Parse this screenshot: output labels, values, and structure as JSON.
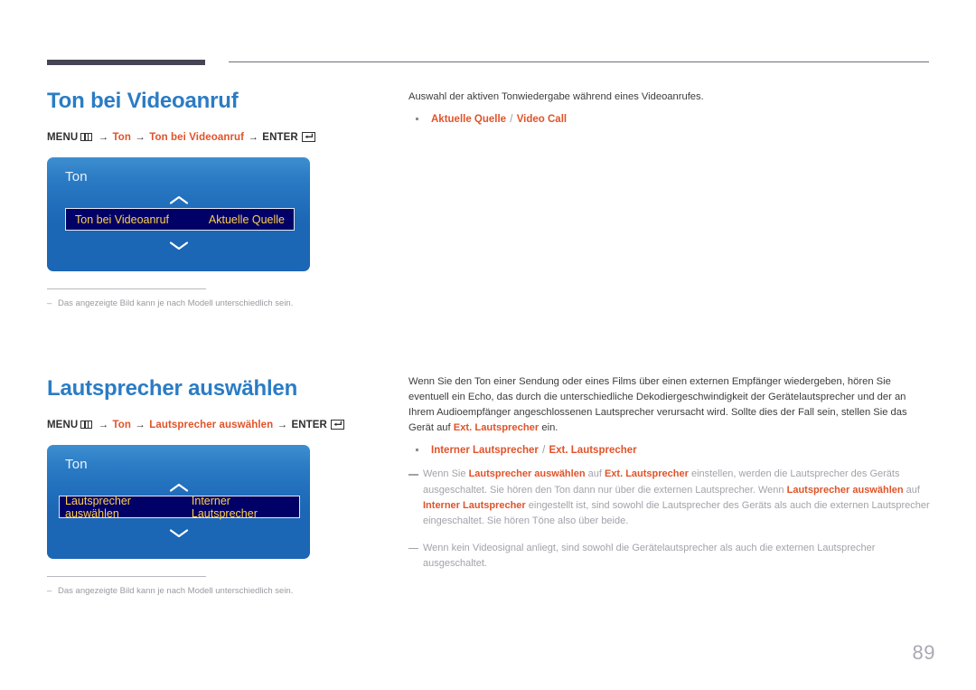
{
  "page": {
    "number": "89"
  },
  "sections": [
    {
      "title": "Ton bei Videoanruf",
      "menu_path": {
        "menu_label": "MENU",
        "arrow": "→",
        "step1": "Ton",
        "step2": "Ton bei Videoanruf",
        "enter_label": "ENTER"
      },
      "osd": {
        "title": "Ton",
        "item_label": "Ton bei Videoanruf",
        "item_value": "Aktuelle Quelle"
      },
      "caption": {
        "dash": "–",
        "text": "Das angezeigte Bild kann je nach Modell unterschiedlich sein."
      },
      "description": "Auswahl der aktiven Tonwiedergabe während eines Videoanrufes.",
      "options": [
        {
          "first": "Aktuelle Quelle",
          "separator": "/",
          "second": "Video Call"
        }
      ],
      "notes": []
    },
    {
      "title": "Lautsprecher auswählen",
      "menu_path": {
        "menu_label": "MENU",
        "arrow": "→",
        "step1": "Ton",
        "step2": "Lautsprecher auswählen",
        "enter_label": "ENTER"
      },
      "osd": {
        "title": "Ton",
        "item_label": "Lautsprecher auswählen",
        "item_value": "Interner Lautsprecher"
      },
      "caption": {
        "dash": "–",
        "text": "Das angezeigte Bild kann je nach Modell unterschiedlich sein."
      },
      "description_parts": {
        "a": "Wenn Sie den Ton einer Sendung oder eines Films über einen externen Empfänger wiedergeben, hören Sie eventuell ein Echo, das durch die unterschiedliche Dekodiergeschwindigkeit der Gerätelautsprecher und der an Ihrem Audioempfänger angeschlossenen Lautsprecher verursacht wird. Sollte dies der Fall sein, stellen Sie das Gerät auf ",
        "hl": "Ext. Lautsprecher",
        "b": " ein."
      },
      "options": [
        {
          "first": "Interner Lautsprecher",
          "separator": "/",
          "second": "Ext. Lautsprecher"
        }
      ],
      "notes": [
        {
          "p1": "Wenn Sie ",
          "h1": "Lautsprecher auswählen",
          "p2": " auf ",
          "h2": "Ext. Lautsprecher",
          "p3": " einstellen, werden die Lautsprecher des Geräts ausgeschaltet. Sie hören den Ton dann nur über die externen Lautsprecher. Wenn ",
          "h3": "Lautsprecher auswählen",
          "p4": " auf ",
          "h4": "Interner Lautsprecher",
          "p5": " eingestellt ist, sind sowohl die Lautsprecher des Geräts als auch die externen Lautsprecher eingeschaltet. Sie hören Töne also über beide."
        },
        {
          "p1": "Wenn kein Videosignal anliegt, sind sowohl die Gerätelautsprecher als auch die externen Lautsprecher ausgeschaltet.",
          "h1": "",
          "p2": "",
          "h2": "",
          "p3": "",
          "h3": "",
          "p4": "",
          "h4": "",
          "p5": ""
        }
      ]
    }
  ],
  "colors": {
    "accent_blue": "#2b7cc4",
    "accent_orange": "#e0532a",
    "osd_blue": "#1b66b5",
    "osd_row_navy": "#000066",
    "osd_row_text": "#ffd24d"
  }
}
